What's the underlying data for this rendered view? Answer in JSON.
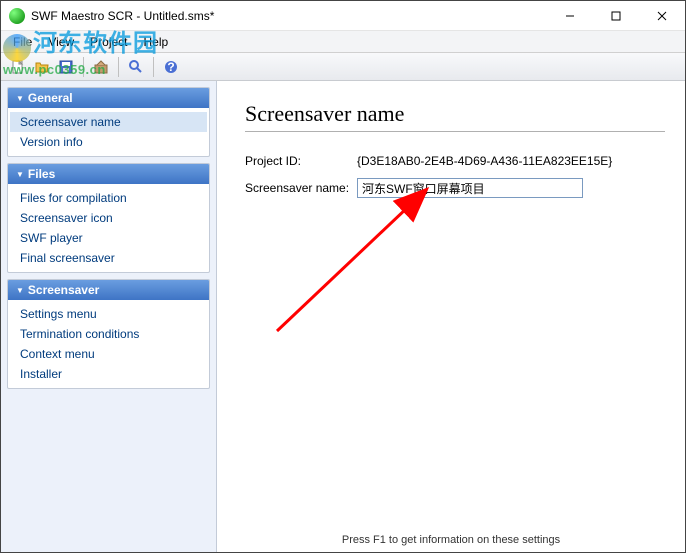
{
  "window": {
    "title": "SWF Maestro SCR - Untitled.sms*"
  },
  "menu": {
    "file": "File",
    "view": "View",
    "project": "Project",
    "help": "Help"
  },
  "sidebar": {
    "general": {
      "header": "General",
      "items": [
        "Screensaver name",
        "Version info"
      ]
    },
    "files": {
      "header": "Files",
      "items": [
        "Files for compilation",
        "Screensaver icon",
        "SWF player",
        "Final screensaver"
      ]
    },
    "screensaver": {
      "header": "Screensaver",
      "items": [
        "Settings menu",
        "Termination conditions",
        "Context menu",
        "Installer"
      ]
    }
  },
  "content": {
    "heading": "Screensaver name",
    "project_id_label": "Project ID:",
    "project_id_value": "{D3E18AB0-2E4B-4D69-A436-11EA823EE15E}",
    "name_label": "Screensaver name:",
    "name_value": "河东SWF窗口屏幕项目"
  },
  "status": {
    "hint": "Press F1 to get information on these settings"
  },
  "watermark": {
    "text": "河东软件园",
    "url": "www.pc0359.cn"
  }
}
